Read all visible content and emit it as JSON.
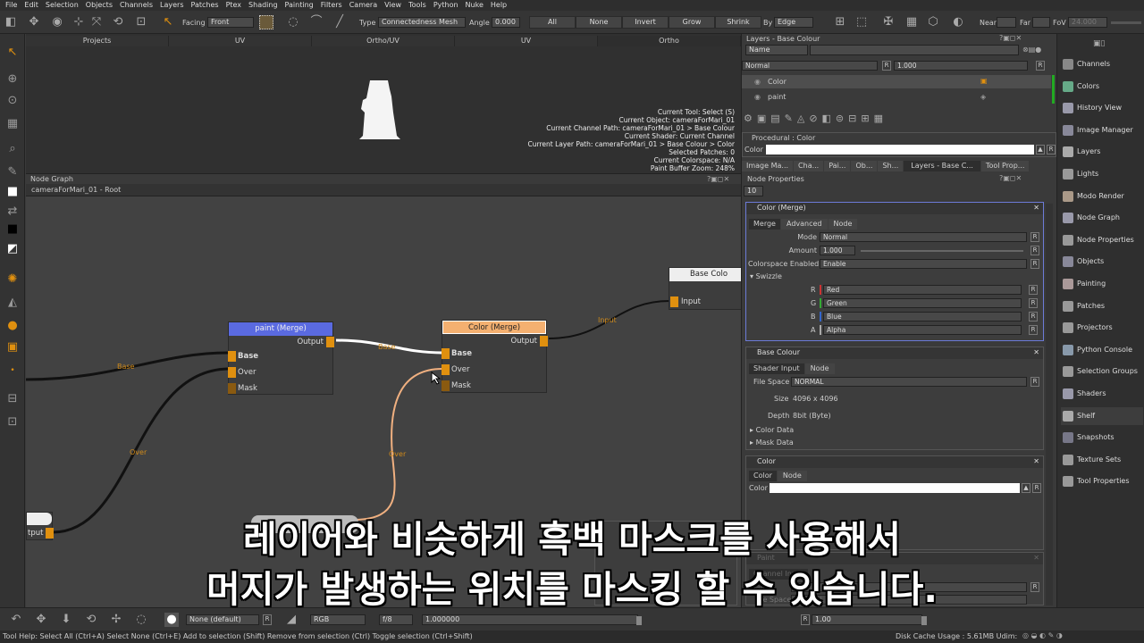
{
  "menu": [
    "File",
    "Edit",
    "Selection",
    "Objects",
    "Channels",
    "Layers",
    "Patches",
    "Ptex",
    "Shading",
    "Painting",
    "Filters",
    "Camera",
    "View",
    "Tools",
    "Python",
    "Nuke",
    "Help"
  ],
  "toolbar": {
    "facing_label": "Facing",
    "facing_value": "Front",
    "type_label": "Type",
    "type_value": "Connectedness Mesh",
    "angle_label": "Angle",
    "angle_value": "0.000",
    "all": "All",
    "none": "None",
    "invert": "Invert",
    "grow": "Grow",
    "shrink": "Shrink",
    "by_label": "By",
    "by_value": "Edge",
    "near_label": "Near",
    "far_label": "Far",
    "fov_label": "FoV",
    "fov_value": "24.000"
  },
  "viewport_tabs": [
    "Projects",
    "UV",
    "Ortho/UV",
    "UV",
    "Ortho"
  ],
  "info_lines": [
    "Current Tool: Select (S)",
    "Current Object: cameraForMari_01",
    "Current Channel Path: cameraForMari_01 > Base Colour",
    "Current Shader: Current Channel",
    "Current Layer Path: cameraForMari_01 > Base Colour > Color",
    "Selected Patches: 0",
    "Current Colorspace: N/A",
    "Paint Buffer Zoom: 248%"
  ],
  "nodegraph": {
    "title": "Node Graph",
    "path": "cameraForMari_01 - Root",
    "paint_node": {
      "title": "paint (Merge)",
      "output": "Output",
      "base": "Base",
      "over": "Over",
      "mask": "Mask"
    },
    "color_node": {
      "title": "Color (Merge)",
      "output": "Output",
      "base": "Base",
      "over": "Over",
      "mask": "Mask"
    },
    "basecolor_node": {
      "title": "Base Colo",
      "input": "Input"
    },
    "left_node": {
      "output": "tput"
    },
    "wire_base1": "Base",
    "wire_base2": "Base",
    "wire_over1": "Over",
    "wire_over2": "Over",
    "wire_input": "Input"
  },
  "layers_panel": {
    "title": "Layers - Base Colour",
    "name_label": "Name",
    "blend": "Normal",
    "blend_amount": "1.000",
    "layers": [
      "Color",
      "paint"
    ],
    "procedural": "Procedural : Color",
    "color_label": "Color",
    "tabs": [
      "Image Ma...",
      "Cha...",
      "Pai...",
      "Ob...",
      "Sh...",
      "Layers - Base C...",
      "Tool Prop..."
    ]
  },
  "node_props": {
    "title": "Node Properties",
    "count": "10",
    "merge": {
      "title": "Color (Merge)",
      "tabs": [
        "Merge",
        "Advanced",
        "Node"
      ],
      "mode_label": "Mode",
      "mode": "Normal",
      "amount_label": "Amount",
      "amount": "1.000",
      "cs_label": "Colorspace Enabled",
      "cs": "Enable",
      "swizzle": "Swizzle",
      "channels": [
        {
          "k": "R",
          "v": "Red",
          "c": "#c33"
        },
        {
          "k": "G",
          "v": "Green",
          "c": "#3a3"
        },
        {
          "k": "B",
          "v": "Blue",
          "c": "#36c"
        },
        {
          "k": "A",
          "v": "Alpha",
          "c": "#aaa"
        }
      ]
    },
    "basecolour": {
      "title": "Base Colour",
      "tabs": [
        "Shader Input",
        "Node"
      ],
      "fs_label": "File Space",
      "fs": "NORMAL",
      "size_label": "Size",
      "size": "4096 x 4096",
      "depth_label": "Depth",
      "depth": "8bit  (Byte)",
      "color_data": "Color Data",
      "mask_data": "Mask Data"
    },
    "color": {
      "title": "Color",
      "tabs": [
        "Color",
        "Node"
      ],
      "color_label": "Color"
    },
    "paint": {
      "title": "Paint",
      "tabs": [
        "Channel Input"
      ],
      "manage": "Mana",
      "channel": "Channel",
      "file_space": "File Space",
      "normal": "NORMAL"
    }
  },
  "sidebar": [
    "Channels",
    "Colors",
    "History View",
    "Image Manager",
    "Layers",
    "Lights",
    "Modo Render",
    "Node Graph",
    "Node Properties",
    "Objects",
    "Painting",
    "Patches",
    "Projectors",
    "Python Console",
    "Selection Groups",
    "Shaders",
    "Shelf",
    "Snapshots",
    "Texture Sets",
    "Tool Properties"
  ],
  "bottom": {
    "preset": "None (default)",
    "mode": "RGB",
    "fstop": "f/8",
    "exposure": "1.000000",
    "gain": "1.00"
  },
  "status": {
    "help": "Tool Help:  Select All (Ctrl+A)    Select None (Ctrl+E)    Add to selection (Shift)    Remove from selection (Ctrl)    Toggle selection (Ctrl+Shift)",
    "disk": "Disk Cache Usage : 5.61MB  Udim:"
  },
  "subtitle": [
    "레이어와 비슷하게 흑백 마스크를 사용해서",
    "머지가 발생하는 위치를 마스킹 할 수 있습니다."
  ]
}
